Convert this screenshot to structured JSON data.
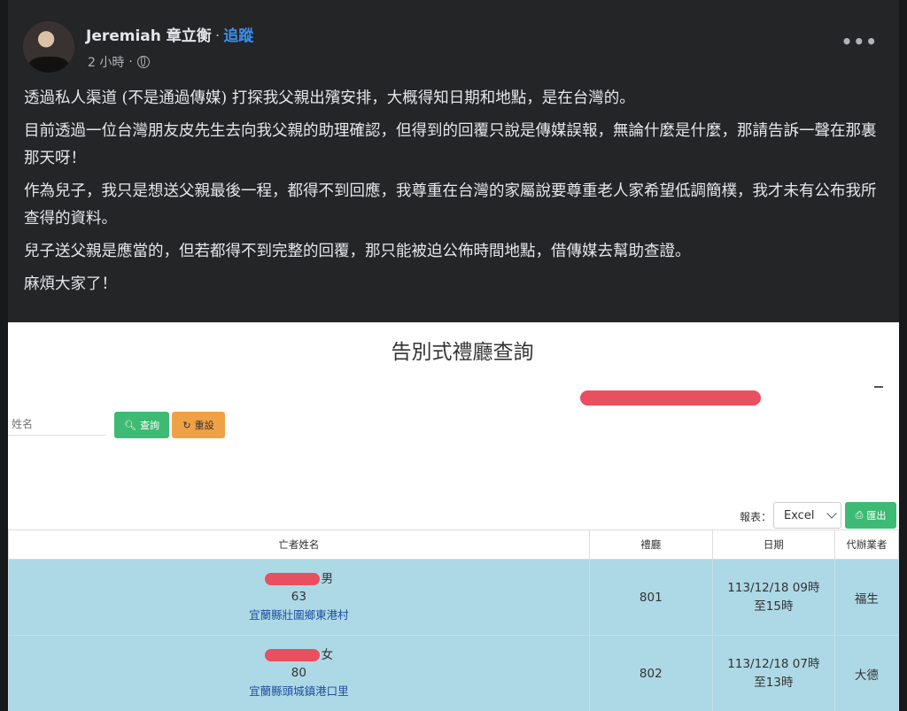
{
  "post": {
    "author": "Jeremiah 章立衡",
    "separator": "·",
    "follow_label": "追蹤",
    "time": "2 小時",
    "more_label": "•••",
    "paragraphs": [
      "透過私人渠道 (不是通過傳媒) 打探我父親出殯安排，大概得知日期和地點，是在台灣的。",
      "目前透過一位台灣朋友皮先生去向我父親的助理確認，但得到的回覆只說是傳媒誤報，無論什麼是什麼，那請告訴一聲在那裏那天呀！",
      "作為兒子，我只是想送父親最後一程，都得不到回應，我尊重在台灣的家屬說要尊重老人家希望低調簡樸，我才未有公布我所查得的資料。",
      "兒子送父親是應當的，但若都得不到完整的回覆，那只能被迫公佈時間地點，借傳媒去幫助查證。",
      "麻煩大家了！"
    ]
  },
  "screenshot": {
    "title": "告別式禮廳查詢",
    "search_placeholder": "姓名",
    "search_button": "查詢",
    "reset_button": "重設",
    "report_label": "報表：",
    "format_select": "Excel",
    "export_button": "匯出",
    "columns": [
      "亡者姓名",
      "禮廳",
      "日期",
      "代辦業者"
    ],
    "rows": [
      {
        "gender": "男",
        "age": "63",
        "address": "宜蘭縣壯圍鄉東港村",
        "hall": "801",
        "date_line1": "113/12/18 09時",
        "date_line2": "至15時",
        "agent": "福生"
      },
      {
        "gender": "女",
        "age": "80",
        "address": "宜蘭縣頭城鎮港口里",
        "hall": "802",
        "date_line1": "113/12/18 07時",
        "date_line2": "至13時",
        "agent": "大德"
      }
    ]
  }
}
